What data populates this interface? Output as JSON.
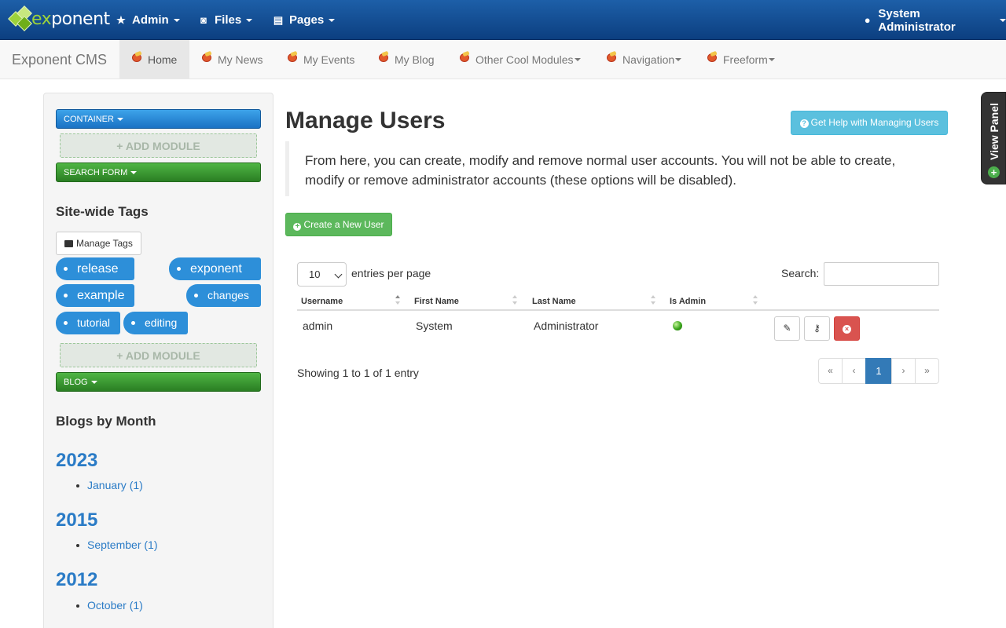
{
  "adminbar": {
    "logo_prefix": "ex",
    "logo_suffix": "ponent",
    "menus": [
      {
        "label": "Admin",
        "icon": "star-icon"
      },
      {
        "label": "Files",
        "icon": "camera-icon"
      },
      {
        "label": "Pages",
        "icon": "document-icon"
      }
    ],
    "user": {
      "label": "System Administrator",
      "icon": "user-icon"
    }
  },
  "sitenav": {
    "brand": "Exponent CMS",
    "items": [
      {
        "label": "Home",
        "active": true
      },
      {
        "label": "My News"
      },
      {
        "label": "My Events"
      },
      {
        "label": "My Blog"
      },
      {
        "label": "Other Cool Modules",
        "dropdown": true
      },
      {
        "label": "Navigation",
        "dropdown": true
      },
      {
        "label": "Freeform",
        "dropdown": true
      }
    ]
  },
  "sidebar": {
    "container_label": "CONTAINER",
    "add_module_label": "ADD MODULE",
    "search_form_label": "SEARCH FORM",
    "tags_title": "Site-wide Tags",
    "manage_tags_label": "Manage Tags",
    "tags": [
      "release",
      "exponent",
      "example",
      "changes",
      "tutorial",
      "editing"
    ],
    "blog_label": "BLOG",
    "blogs_title": "Blogs by Month",
    "archive": [
      {
        "year": "2023",
        "month": "January (1)"
      },
      {
        "year": "2015",
        "month": "September (1)"
      },
      {
        "year": "2012",
        "month": "October (1)"
      }
    ]
  },
  "main": {
    "title": "Manage Users",
    "help_button": "Get Help with Managing Users",
    "intro": "From here, you can create, modify and remove normal user accounts.   You will not be able to create, modify or remove administrator accounts (these options will be disabled).",
    "create_button": "Create a New User",
    "entries_value": "10",
    "entries_label": "entries per page",
    "search_label": "Search:",
    "search_value": "",
    "columns": [
      "Username",
      "First Name",
      "Last Name",
      "Is Admin"
    ],
    "rows": [
      {
        "username": "admin",
        "first_name": "System",
        "last_name": "Administrator",
        "is_admin": true
      }
    ],
    "showing": "Showing 1 to 1 of 1 entry",
    "pager": [
      "«",
      "‹",
      "1",
      "›",
      "»"
    ],
    "current_page": "1"
  },
  "view_panel": {
    "label": "View Panel"
  },
  "colors": {
    "admin_bar": "#0c3f80",
    "tag": "#2d8fd9",
    "success": "#5cb85c",
    "info": "#5bc0de",
    "danger": "#d9534f",
    "link": "#2a7bc6"
  }
}
